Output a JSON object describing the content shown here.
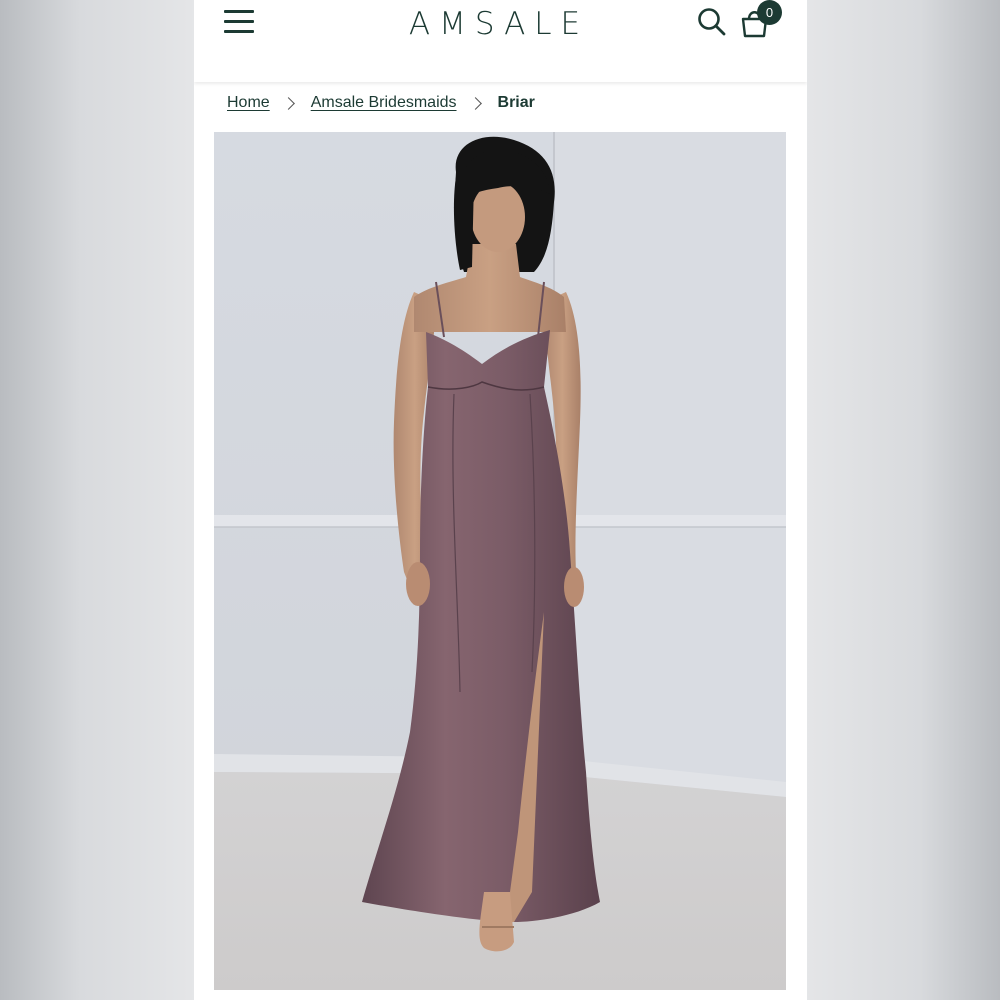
{
  "header": {
    "logo": "AMSALE",
    "cart_count": "0",
    "icons": {
      "menu": "hamburger-menu-icon",
      "search": "search-icon",
      "bag": "shopping-bag-icon"
    }
  },
  "breadcrumb": {
    "items": [
      {
        "label": "Home"
      },
      {
        "label": "Amsale Bridesmaids"
      }
    ],
    "current": "Briar"
  },
  "colors": {
    "brand": "#1c3a33",
    "dress": "#7a5a66",
    "wall": "#d7dae0"
  }
}
